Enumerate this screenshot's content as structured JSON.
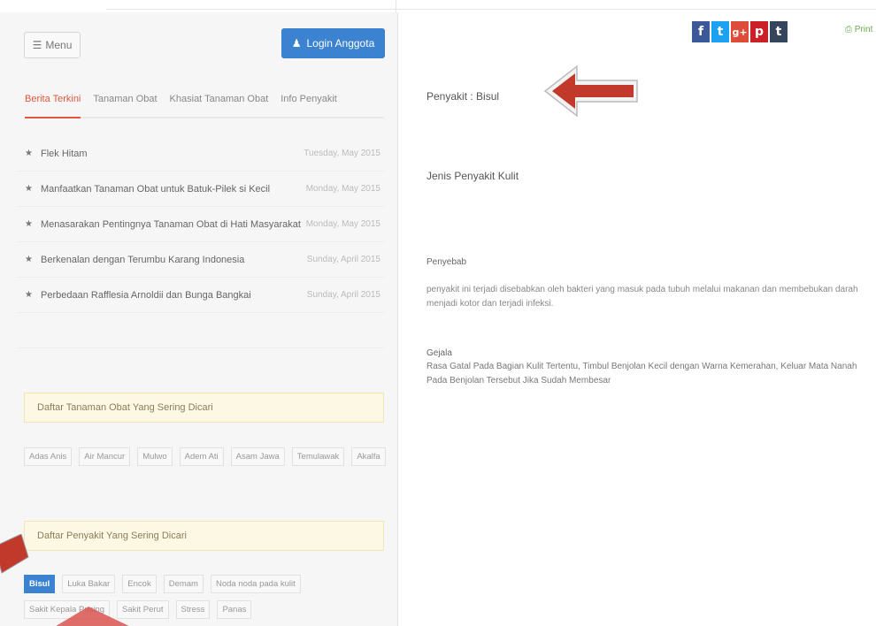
{
  "header": {
    "menu_label": "Menu",
    "menu_icon": "hamburger-icon",
    "login_label": "Login Anggota",
    "login_icon": "user-icon",
    "accent_color": "#3b82d1"
  },
  "tabs": [
    {
      "label": "Berita Terkini",
      "active": true
    },
    {
      "label": "Tanaman Obat",
      "active": false
    },
    {
      "label": "Khasiat Tanaman Obat",
      "active": false
    },
    {
      "label": "Info Penyakit",
      "active": false
    }
  ],
  "news": [
    {
      "title": "Flek Hitam",
      "date": "Tuesday, May 2015"
    },
    {
      "title": "Manfaatkan Tanaman Obat untuk Batuk-Pilek si Kecil",
      "date": "Monday, May 2015"
    },
    {
      "title": "Menasarakan Pentingnya Tanaman Obat di Hati Masyarakat",
      "date": "Monday, May 2015"
    },
    {
      "title": "Berkenalan dengan Terumbu Karang Indonesia",
      "date": "Sunday, April 2015"
    },
    {
      "title": "Perbedaan Rafflesia Arnoldii dan Bunga Bangkai",
      "date": "Sunday, April 2015"
    }
  ],
  "sidebar": {
    "plants_box_title": "Daftar Tanaman Obat Yang Sering Dicari",
    "plants_tags": [
      "Adas Anis",
      "Air Mancur",
      "Mulwo",
      "Adem Ati",
      "Asam Jawa",
      "Temulawak",
      "Akalfa"
    ],
    "diseases_box_title": "Daftar Penyakit Yang Sering Dicari",
    "diseases_tags": [
      "Bisul",
      "Luka Bakar",
      "Encok",
      "Demam",
      "Noda noda pada kulit",
      "Sakit Kepala Pusing",
      "Sakit Perut",
      "Stress",
      "Panas"
    ]
  },
  "social": {
    "icons": [
      "facebook-icon",
      "twitter-icon",
      "google-plus-icon",
      "pinterest-icon",
      "tumblr-icon"
    ],
    "glyphs": [
      "f",
      "t",
      "g+",
      "p",
      "t"
    ],
    "print_label": "Print"
  },
  "article": {
    "title": "Penyakit : Bisul",
    "category": "Jenis Penyakit Kulit",
    "penyebab_label": "Penyebab",
    "penyebab_text": "penyakit ini terjadi disebabkan oleh bakteri yang masuk pada tubuh melalui makanan dan membebukan darah menjadi kotor dan terjadi infeksi.",
    "gejala_label": "Gejala",
    "gejala_text": "Rasa Gatal Pada Bagian Kulit Tertentu, Timbul Benjolan Kecil dengan Warna Kemerahan, Keluar Mata Nanah Pada Benjolan Tersebut Jika Sudah Membesar"
  }
}
